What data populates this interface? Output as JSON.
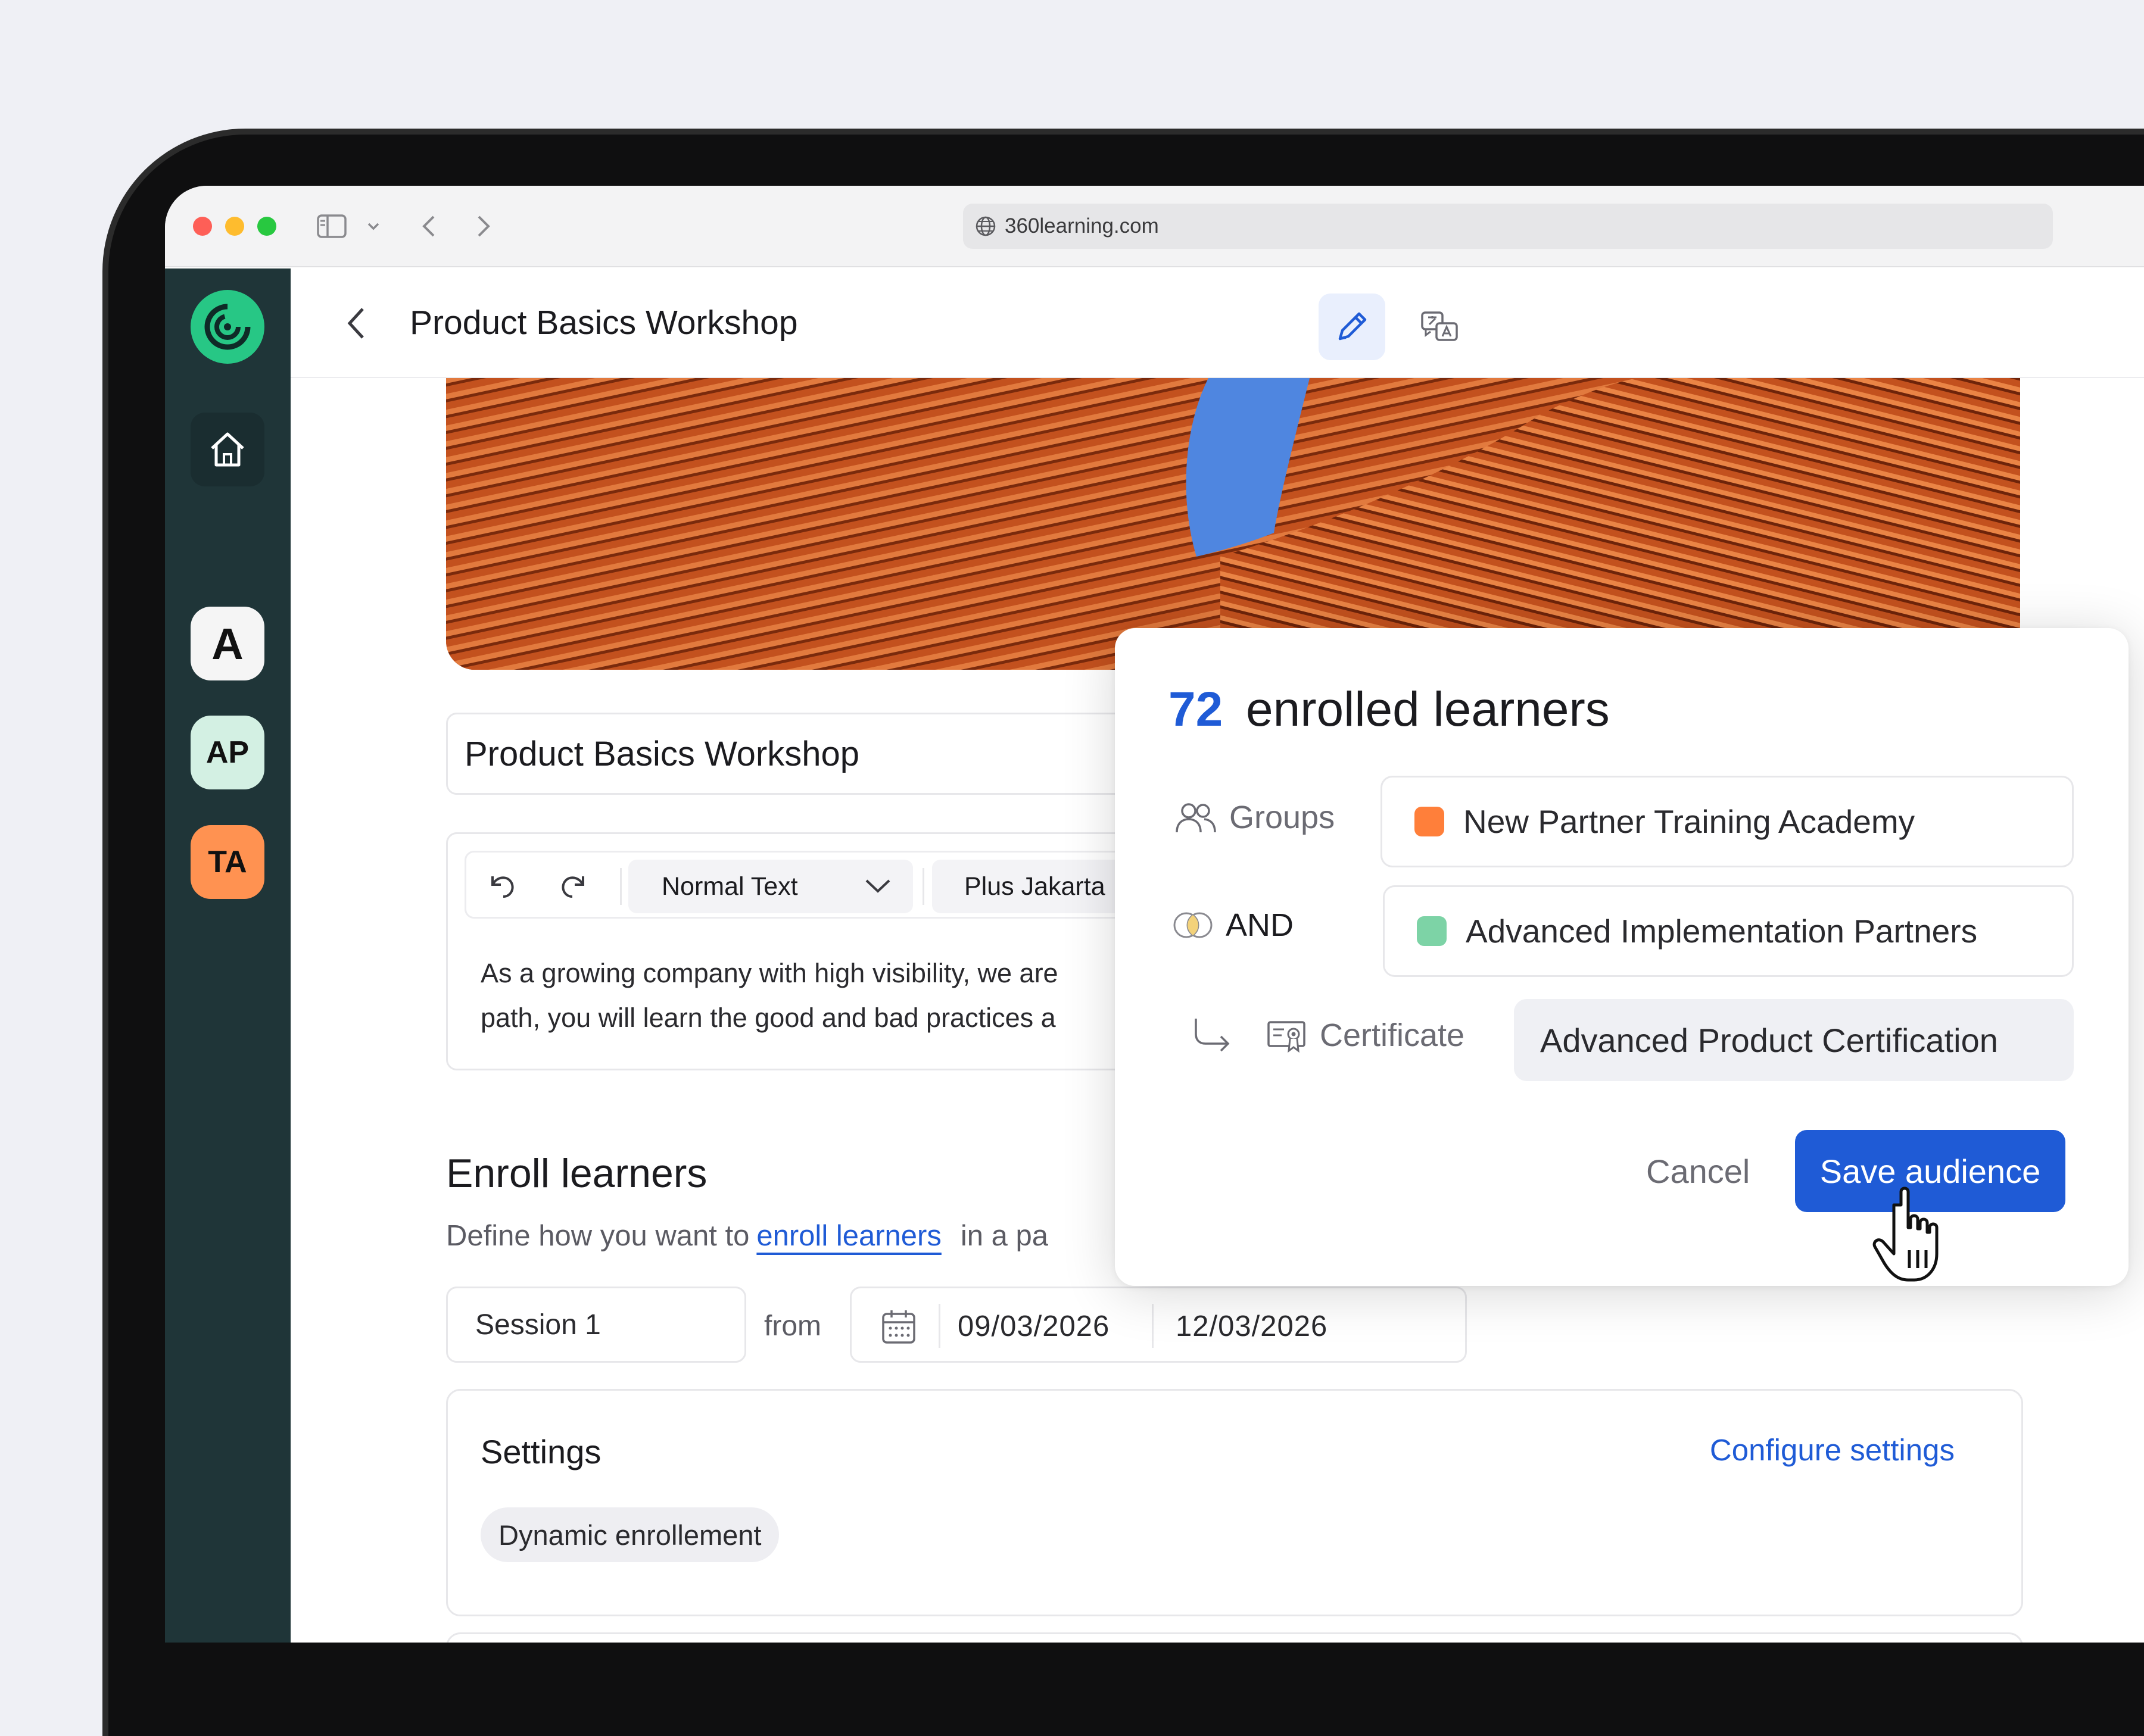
{
  "browser": {
    "url": "360learning.com",
    "traffic_lights": {
      "close": "#fe5f57",
      "minimize": "#febc2e",
      "zoom": "#28c840"
    }
  },
  "sidebar": {
    "background": "#1f3538",
    "logo_color": "#27c785",
    "workspaces": [
      {
        "label": "A",
        "color": "#f5f5f5"
      },
      {
        "label": "AP",
        "color": "#d3f0e3"
      },
      {
        "label": "TA",
        "color": "#ff9251"
      }
    ]
  },
  "header": {
    "title": "Product Basics Workshop"
  },
  "course": {
    "title": "Product Basics Workshop",
    "toolbar": {
      "text_style": "Normal Text",
      "font": "Plus Jakarta"
    },
    "description_lines": [
      "As a growing company with high visibility, we are",
      "path, you will learn the good and bad practices a"
    ]
  },
  "enroll": {
    "title": "Enroll learners",
    "desc_prefix": "Define how you want to",
    "desc_link": "enroll learners",
    "desc_suffix": "in a pa",
    "session": "Session 1",
    "from_label": "from",
    "start_date": "09/03/2026",
    "end_date": "12/03/2026"
  },
  "settings": {
    "title": "Settings",
    "configure_link": "Configure settings",
    "chip": "Dynamic enrollement"
  },
  "audience_popup": {
    "count": "72",
    "heading": "enrolled learners",
    "groups_label": "Groups",
    "group_1": {
      "name": "New Partner Training Academy",
      "color": "#ff7f3a"
    },
    "and_label": "AND",
    "group_2": {
      "name": "Advanced Implementation Partners",
      "color": "#7dd3a6"
    },
    "certificate_label": "Certificate",
    "certificate_value": "Advanced Product Certification",
    "cancel_label": "Cancel",
    "save_label": "Save audience",
    "accent": "#1f5bd6"
  }
}
